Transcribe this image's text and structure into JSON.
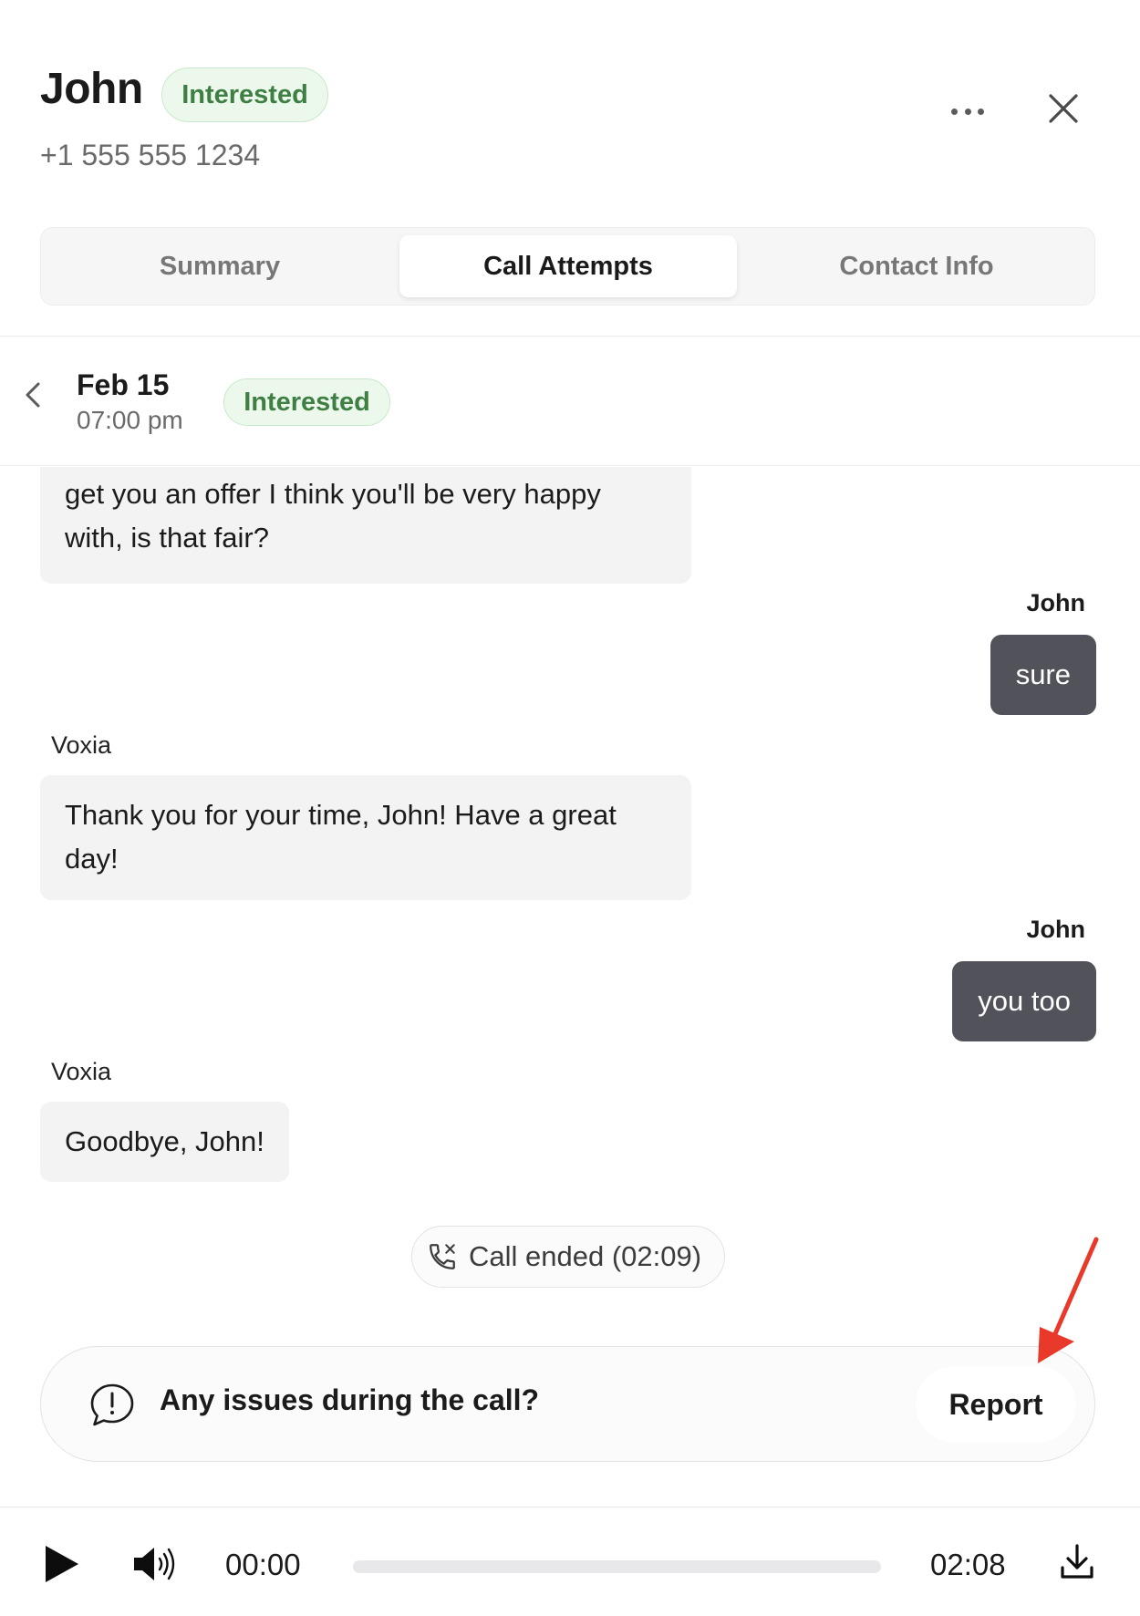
{
  "contact": {
    "name": "John",
    "status": "Interested",
    "phone": "+1 555 555 1234"
  },
  "header": {
    "more_icon": "more-horizontal-icon",
    "close_icon": "close-icon"
  },
  "tabs": [
    {
      "label": "Summary",
      "active": false
    },
    {
      "label": "Call Attempts",
      "active": true
    },
    {
      "label": "Contact Info",
      "active": false
    }
  ],
  "call": {
    "date": "Feb 15",
    "time": "07:00 pm",
    "status": "Interested"
  },
  "transcript": {
    "messages": [
      {
        "speaker": "",
        "side": "agent",
        "text": "get you an offer I think you'll be very happy with, is that fair?"
      },
      {
        "speaker": "John",
        "side": "user",
        "text": "sure"
      },
      {
        "speaker": "Voxia",
        "side": "agent",
        "text": "Thank you for your time, John! Have a great day!"
      },
      {
        "speaker": "John",
        "side": "user",
        "text": "you too"
      },
      {
        "speaker": "Voxia",
        "side": "agent",
        "text": "Goodbye, John!"
      }
    ],
    "call_ended": "Call ended (02:09)"
  },
  "issue_bar": {
    "text": "Any issues during the call?",
    "report_label": "Report"
  },
  "player": {
    "current_time": "00:00",
    "total_time": "02:08",
    "progress": 0
  },
  "colors": {
    "status_green": "#3f7f44",
    "status_bg": "#ecf8ec",
    "user_bubble": "#52525b",
    "agent_bubble": "#f3f3f3",
    "annotation_arrow": "#e8392a"
  }
}
